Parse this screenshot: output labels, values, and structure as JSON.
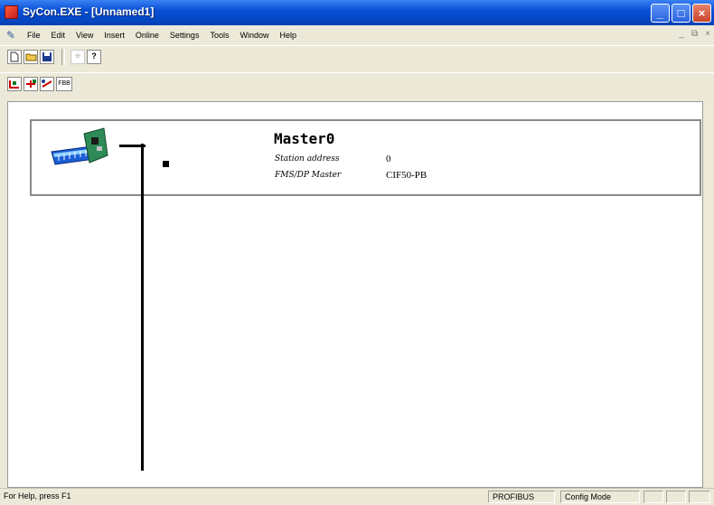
{
  "window": {
    "title": "SyCon.EXE - [Unnamed1]",
    "minimize_glyph": "_",
    "maximize_glyph": "□",
    "close_glyph": "×"
  },
  "menu": {
    "items": [
      "File",
      "Edit",
      "View",
      "Insert",
      "Online",
      "Settings",
      "Tools",
      "Window",
      "Help"
    ],
    "mdi_minimize": "_",
    "mdi_restore": "⧉",
    "mdi_close": "×"
  },
  "toolbar1": {
    "icons": [
      "new-file-icon",
      "open-folder-icon",
      "save-icon",
      "disabled-icon",
      "help-icon"
    ],
    "help_glyph": "?"
  },
  "toolbar2": {
    "icons": [
      "insert-master-icon",
      "insert-slave-icon",
      "connect-icon",
      "bus-parameter-icon"
    ],
    "bus_label": "FBB"
  },
  "network": {
    "master_name": "Master0",
    "station_address_label": "Station address",
    "station_address_value": "0",
    "master_type_label": "FMS/DP Master",
    "master_type_value": "CIF50-PB"
  },
  "status": {
    "help_text": "For Help, press F1",
    "bus": "PROFIBUS",
    "mode": "Config Mode"
  },
  "colors": {
    "titlebar": "#0a50d6",
    "client_background": "#ffffff",
    "window_frame": "#ece9d8"
  }
}
